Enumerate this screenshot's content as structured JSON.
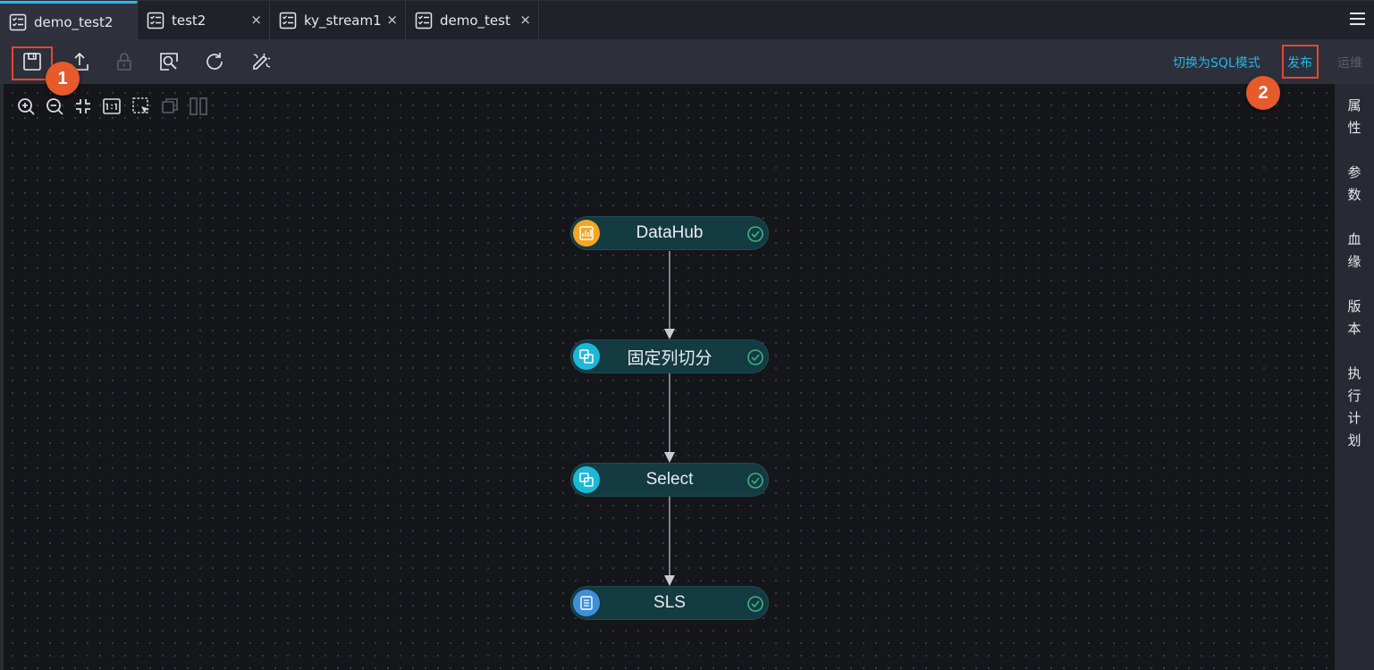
{
  "tabs": [
    {
      "label": "demo_test2",
      "active": true,
      "closable": false
    },
    {
      "label": "test2",
      "active": false,
      "closable": true
    },
    {
      "label": "ky_stream1",
      "active": false,
      "closable": true
    },
    {
      "label": "demo_test",
      "active": false,
      "closable": true
    }
  ],
  "tab_close_glyph": "×",
  "toolbar": {
    "icons": [
      "save-icon",
      "submit-icon",
      "lock-icon",
      "preview-icon",
      "refresh-icon",
      "format-icon"
    ],
    "switch_sql_label": "切换为SQL模式",
    "publish_label": "发布",
    "ops_label": "运维",
    "badge_1": "1",
    "badge_2": "2"
  },
  "canvas_controls": [
    "zoom-in-icon",
    "zoom-out-icon",
    "fit-icon",
    "actual-size-icon",
    "select-icon",
    "group-icon",
    "layout-icon"
  ],
  "nodes": [
    {
      "label": "DataHub",
      "icon": "datahub-icon",
      "icon_color": "#f5a623",
      "status": "success"
    },
    {
      "label": "固定列切分",
      "icon": "transform-icon",
      "icon_color": "#1cb8d8",
      "status": "success"
    },
    {
      "label": "Select",
      "icon": "transform-icon",
      "icon_color": "#1cb8d8",
      "status": "success"
    },
    {
      "label": "SLS",
      "icon": "sls-icon",
      "icon_color": "#3f8fd8",
      "status": "success"
    }
  ],
  "right_panel": [
    "属\n性",
    "参\n数",
    "血\n缘",
    "版\n本",
    "执\n行\n计\n划"
  ],
  "colors": {
    "accent": "#23b7e5",
    "highlight": "#e04a2f",
    "badge": "#e65a2c",
    "success": "#3fb27f"
  }
}
